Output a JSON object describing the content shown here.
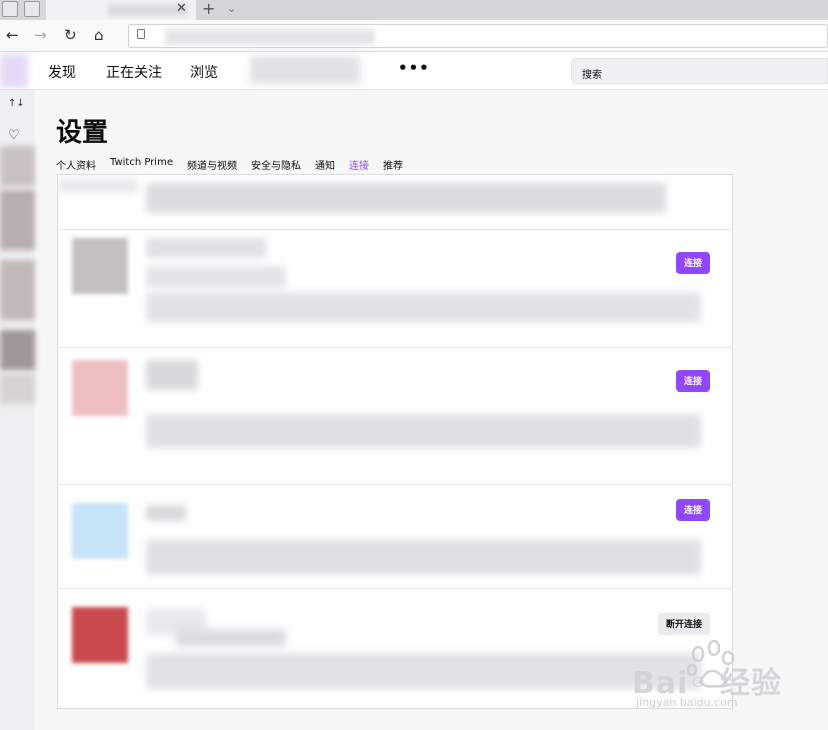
{
  "topnav": {
    "links": [
      "发现",
      "正在关注",
      "浏览"
    ],
    "more": "•••",
    "search_placeholder": "搜索"
  },
  "settings": {
    "title": "设置",
    "tabs": [
      "个人资料",
      "Twitch Prime",
      "频道与视频",
      "安全与隐私",
      "通知",
      "连接",
      "推荐"
    ],
    "active_tab": "连接"
  },
  "connections": {
    "connect_label": "连接",
    "disconnect_label": "断开连接"
  },
  "watermark": {
    "text": "Bai◦ 经验",
    "url": "jingyan.baidu.com"
  },
  "colors": {
    "accent": "#9147ff"
  }
}
